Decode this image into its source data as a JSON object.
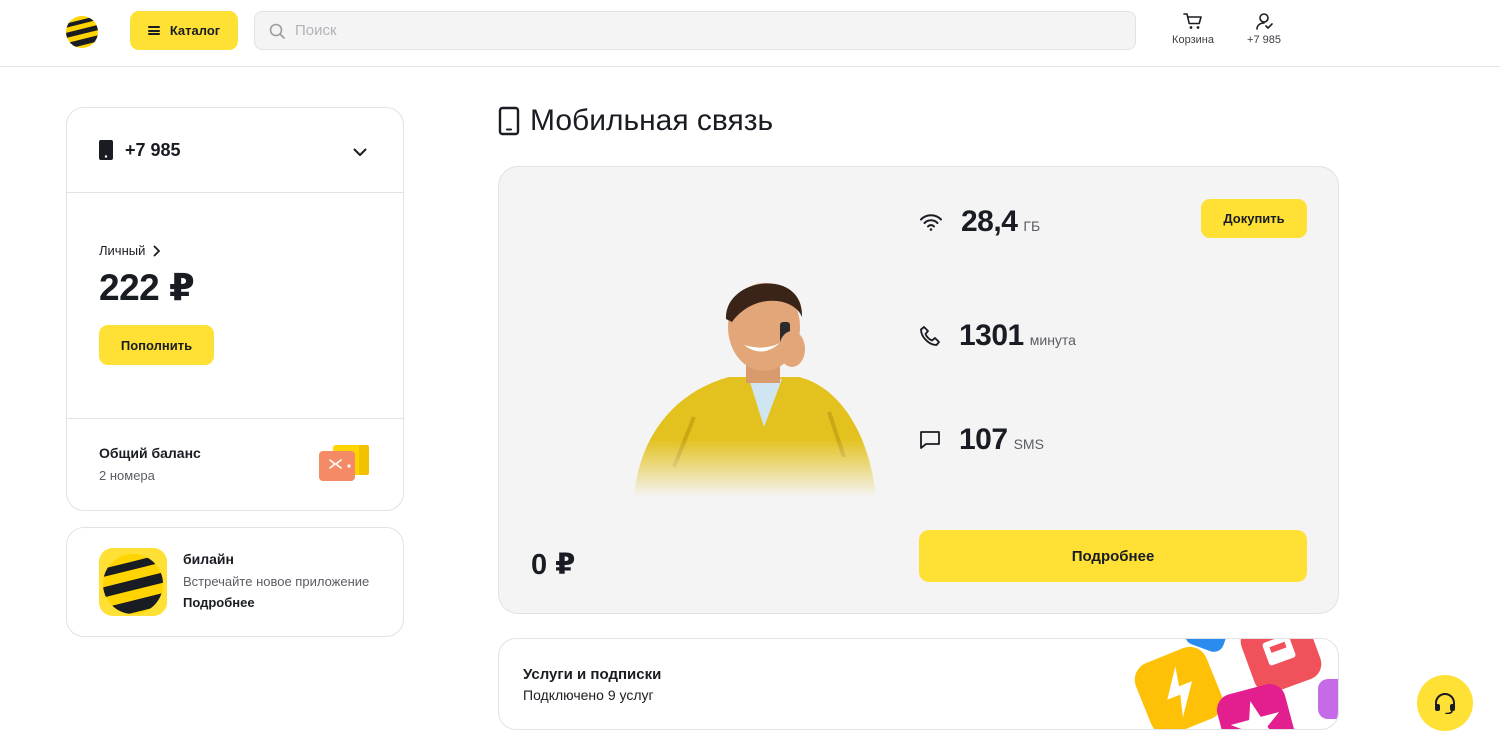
{
  "header": {
    "catalog_label": "Каталог",
    "search_placeholder": "Поиск",
    "cart_label": "Корзина",
    "profile_label": "+7 985"
  },
  "account": {
    "phone": "+7 985",
    "account_type": "Личный",
    "balance": "222 ₽",
    "topup_label": "Пополнить",
    "shared_title": "Общий баланс",
    "shared_sub": "2 номера"
  },
  "app_promo": {
    "name": "билайн",
    "desc": "Встречайте новое приложение",
    "more_label": "Подробнее"
  },
  "mobile": {
    "section_title": "Мобильная связь",
    "price": "0 ₽",
    "internet_value": "28,4",
    "internet_unit": "ГБ",
    "calls_value": "1301",
    "calls_unit": "минута",
    "sms_value": "107",
    "sms_unit": "SMS",
    "buy_label": "Докупить",
    "details_label": "Подробнее"
  },
  "services": {
    "title": "Услуги и подписки",
    "subtitle": "Подключено 9 услуг"
  },
  "colors": {
    "accent": "#ffe035",
    "text": "#191c22",
    "card_bg": "#f4f4f5",
    "border": "#e2e2e4"
  },
  "icons": [
    "beeline-logo",
    "menu-icon",
    "search-icon",
    "cart-icon",
    "user-icon",
    "phone-icon",
    "chevron-down-icon",
    "chevron-right-icon",
    "wallet-icon",
    "wifi-icon",
    "call-icon",
    "sms-icon",
    "headset-icon"
  ]
}
